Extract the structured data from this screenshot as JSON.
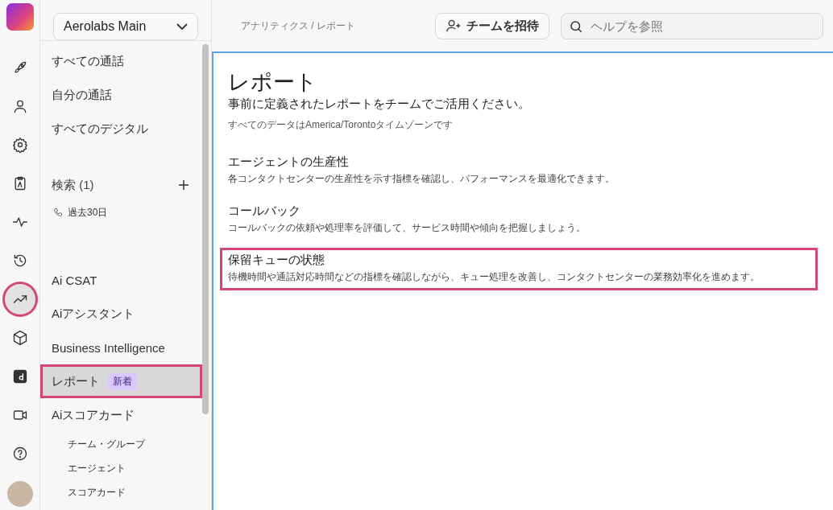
{
  "rail": {
    "items": [
      {
        "selected": false,
        "highlighted": false
      },
      {
        "selected": false,
        "highlighted": false
      },
      {
        "selected": false,
        "highlighted": false
      },
      {
        "selected": false,
        "highlighted": false
      },
      {
        "selected": false,
        "highlighted": false
      },
      {
        "selected": false,
        "highlighted": false
      },
      {
        "selected": true,
        "highlighted": true
      },
      {
        "selected": false,
        "highlighted": false
      },
      {
        "selected": false,
        "highlighted": false
      },
      {
        "selected": false,
        "highlighted": false
      },
      {
        "selected": false,
        "highlighted": false
      }
    ]
  },
  "sidebar": {
    "workspace": "Aerolabs Main",
    "groups": [
      {
        "items": [
          {
            "kind": "item",
            "label": "すべての通話",
            "selected": false,
            "highlighted": false
          },
          {
            "kind": "item",
            "label": "自分の通話",
            "selected": false,
            "highlighted": false
          },
          {
            "kind": "item",
            "label": "すべてのデジタル",
            "selected": false,
            "highlighted": false
          }
        ]
      },
      {
        "items": [
          {
            "kind": "section",
            "label": "検索 (1)"
          },
          {
            "kind": "saved",
            "label": "過去30日"
          }
        ]
      },
      {
        "items": [
          {
            "kind": "item",
            "label": "Ai CSAT",
            "selected": false,
            "highlighted": false
          },
          {
            "kind": "item",
            "label": "Aiアシスタント",
            "selected": false,
            "highlighted": false
          },
          {
            "kind": "item",
            "label": "Business Intelligence",
            "selected": false,
            "highlighted": false
          },
          {
            "kind": "item",
            "label": "レポート",
            "badge": "新着",
            "selected": true,
            "highlighted": true
          },
          {
            "kind": "item",
            "label": "Aiスコアカード",
            "selected": false,
            "highlighted": false,
            "children": [
              {
                "kind": "child",
                "label": "チーム・グループ",
                "selected": false,
                "highlighted": false
              },
              {
                "kind": "child",
                "label": "エージェント",
                "selected": false,
                "highlighted": false
              },
              {
                "kind": "child",
                "label": "スコアカード",
                "selected": false,
                "highlighted": false
              }
            ]
          }
        ]
      }
    ]
  },
  "header": {
    "breadcrumb": "アナリティクス / レポート",
    "invite_button": "チームを招待",
    "search": {
      "placeholder": "ヘルプを参照"
    }
  },
  "main": {
    "title": "レポート",
    "subtitle": "事前に定義されたレポートをチームでご活用ください。",
    "timezone_note": "すべてのデータはAmerica/Torontoタイムゾーンです",
    "reports": [
      {
        "title": "エージェントの生産性",
        "description": "各コンタクトセンターの生産性を示す指標を確認し、パフォーマンスを最適化できます。",
        "highlighted": false
      },
      {
        "title": "コールバック",
        "description": "コールバックの依頼や処理率を評価して、サービス時間や傾向を把握しましょう。",
        "highlighted": false
      },
      {
        "title": "保留キューの状態",
        "description": "待機時間や通話対応時間などの指標を確認しながら、キュー処理を改善し、コンタクトセンターの業務効率化を進めます。",
        "highlighted": true
      }
    ]
  }
}
